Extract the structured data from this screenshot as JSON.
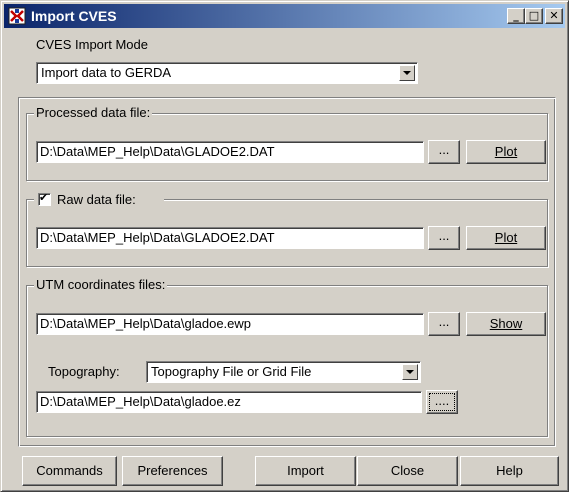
{
  "window": {
    "title": "Import CVES"
  },
  "title_buttons": {
    "minimize": "_",
    "maximize": "□",
    "close": "✕"
  },
  "import_mode": {
    "label": "CVES Import Mode",
    "selected": "Import data to GERDA"
  },
  "processed": {
    "legend": "Processed data file:",
    "path": "D:\\Data\\MEP_Help\\Data\\GLADOE2.DAT",
    "browse_label": "...",
    "plot_label": "Plot"
  },
  "raw": {
    "legend": "Raw data file:",
    "checked": true,
    "check_mark": "✔",
    "path": "D:\\Data\\MEP_Help\\Data\\GLADOE2.DAT",
    "browse_label": "...",
    "plot_label": "Plot"
  },
  "utm": {
    "legend": "UTM coordinates files:",
    "path": "D:\\Data\\MEP_Help\\Data\\gladoe.ewp",
    "browse_label": "...",
    "show_label": "Show",
    "topography_label": "Topography:",
    "topography_selected": "Topography File or Grid File",
    "topography_path": "D:\\Data\\MEP_Help\\Data\\gladoe.ez",
    "topography_browse_label": "...."
  },
  "footer": {
    "commands": "Commands",
    "preferences": "Preferences",
    "import": "Import",
    "close": "Close",
    "help": "Help"
  },
  "icons": {
    "app": "cves-app-icon",
    "dropdown": "chevron-down-icon"
  },
  "colors": {
    "title_start": "#0a246a",
    "title_end": "#a6caf0",
    "face": "#d4d0c8"
  }
}
